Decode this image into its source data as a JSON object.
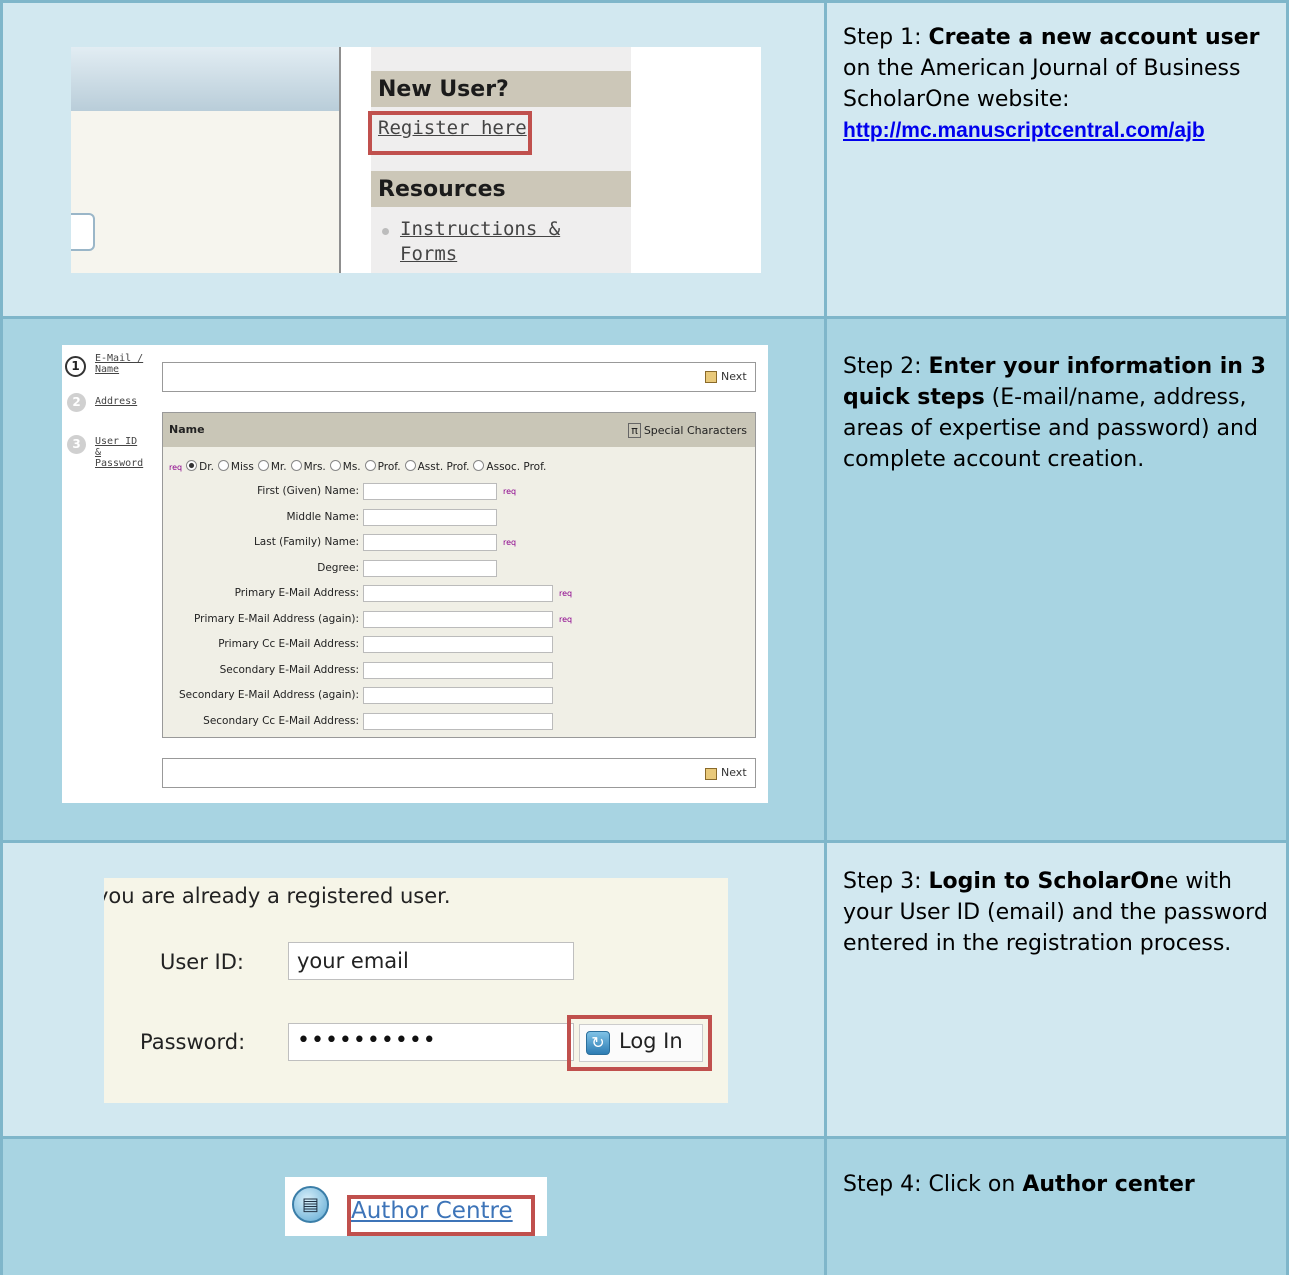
{
  "rows": [
    {
      "step_prefix": "Step 1: ",
      "step_bold": "Create a new account user",
      "step_rest": " on the American Journal of Business ScholarOne website:",
      "link": "http://mc.manuscriptcentral.com/ajb",
      "image": {
        "new_user": "New User?",
        "register": "Register here",
        "resources": "Resources",
        "instr_1": "Instructions &",
        "instr_2": "Forms"
      }
    },
    {
      "step_prefix": "Step 2: ",
      "step_bold": "Enter your information in 3 quick steps",
      "step_rest": " (E-mail/name, address, areas of expertise and password) and complete account creation.",
      "image": {
        "steps": [
          {
            "num": "1",
            "label_1": "E-Mail /",
            "label_2": "Name"
          },
          {
            "num": "2",
            "label_1": "Address",
            "label_2": ""
          },
          {
            "num": "3",
            "label_1": "User ID",
            "label_2": "&",
            "label_3": "Password"
          }
        ],
        "next": "Next",
        "form_title": "Name",
        "special": "Special Characters",
        "pi": "π",
        "req": "req",
        "salutations": [
          "Dr.",
          "Miss",
          "Mr.",
          "Mrs.",
          "Ms.",
          "Prof.",
          "Asst. Prof.",
          "Assoc. Prof."
        ],
        "fields": [
          {
            "label": "First (Given) Name:",
            "req": true
          },
          {
            "label": "Middle Name:",
            "req": false
          },
          {
            "label": "Last (Family) Name:",
            "req": true
          },
          {
            "label": "Degree:",
            "req": false
          },
          {
            "label": "Primary E-Mail Address:",
            "req": true
          },
          {
            "label": "Primary E-Mail Address (again):",
            "req": true
          },
          {
            "label": "Primary Cc E-Mail Address:",
            "req": false
          },
          {
            "label": "Secondary E-Mail Address:",
            "req": false
          },
          {
            "label": "Secondary E-Mail Address (again):",
            "req": false
          },
          {
            "label": "Secondary Cc E-Mail Address:",
            "req": false
          }
        ]
      }
    },
    {
      "step_prefix": "Step 3: ",
      "step_bold": "Login to ScholarOn",
      "step_rest": "e with your User ID (email) and the password entered in the registration process.",
      "image": {
        "intro": "you are already a registered user.",
        "userid_label": "User ID:",
        "userid_value": "your email",
        "password_label": "Password:",
        "password_value": "••••••••••",
        "login": "Log In"
      }
    },
    {
      "step_prefix": "Step 4: Click on ",
      "step_bold": "Author center",
      "step_rest": "",
      "image": {
        "link": "Author Centre"
      }
    }
  ]
}
